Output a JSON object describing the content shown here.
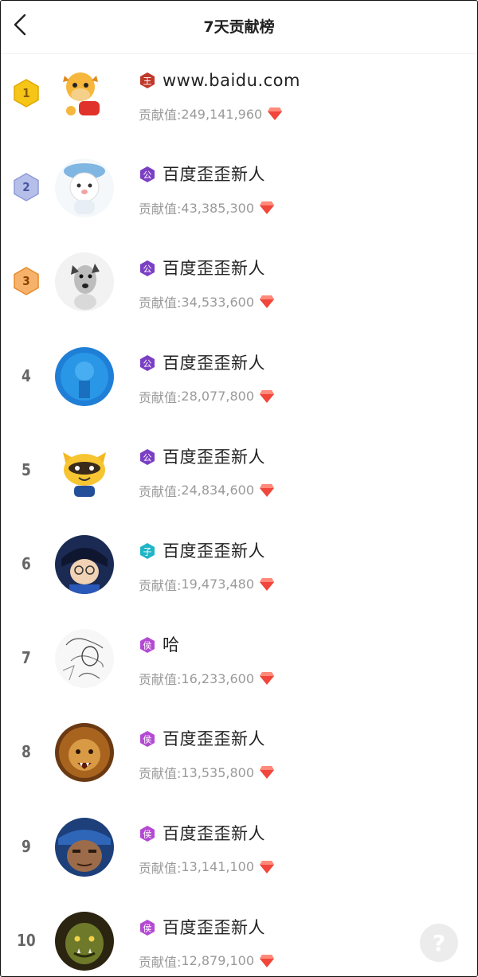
{
  "header": {
    "title": "7天贡献榜"
  },
  "contribution_label": "贡献值: ",
  "help_label": "?",
  "colors": {
    "gold": "#f5c518",
    "silver": "#8e9bd6",
    "bronze": "#f19a3e",
    "badge_red": "#c0392b",
    "badge_purple": "#7b3fc4",
    "badge_teal": "#1fb5c7",
    "badge_magenta": "#b44ad3",
    "gem": "#f0463c"
  },
  "rows": [
    {
      "rank": "1",
      "name": "www.baidu.com",
      "badge_char": "王",
      "badge_color": "#c0392b",
      "value": "249,141,960",
      "avatar": "cartoon-cow"
    },
    {
      "rank": "2",
      "name": "百度歪歪新人",
      "badge_char": "公",
      "badge_color": "#7b3fc4",
      "value": "43,385,300",
      "avatar": "cartoon-bear-hat"
    },
    {
      "rank": "3",
      "name": "百度歪歪新人",
      "badge_char": "公",
      "badge_color": "#7b3fc4",
      "value": "34,533,600",
      "avatar": "dog"
    },
    {
      "rank": "4",
      "name": "百度歪歪新人",
      "badge_char": "公",
      "badge_color": "#7b3fc4",
      "value": "28,077,800",
      "avatar": "blue-ocean"
    },
    {
      "rank": "5",
      "name": "百度歪歪新人",
      "badge_char": "公",
      "badge_color": "#7b3fc4",
      "value": "24,834,600",
      "avatar": "cartoon-raccoon"
    },
    {
      "rank": "6",
      "name": "百度歪歪新人",
      "badge_char": "子",
      "badge_color": "#1fb5c7",
      "value": "19,473,480",
      "avatar": "anime-detective"
    },
    {
      "rank": "7",
      "name": "哈",
      "badge_char": "侯",
      "badge_color": "#b44ad3",
      "value": "16,233,600",
      "avatar": "sketch-drawing"
    },
    {
      "rank": "8",
      "name": "百度歪歪新人",
      "badge_char": "侯",
      "badge_color": "#b44ad3",
      "value": "13,535,800",
      "avatar": "lion"
    },
    {
      "rank": "9",
      "name": "百度歪歪新人",
      "badge_char": "侯",
      "badge_color": "#b44ad3",
      "value": "13,141,100",
      "avatar": "warrior-face"
    },
    {
      "rank": "10",
      "name": "百度歪歪新人",
      "badge_char": "侯",
      "badge_color": "#b44ad3",
      "value": "12,879,100",
      "avatar": "orc-face"
    }
  ]
}
